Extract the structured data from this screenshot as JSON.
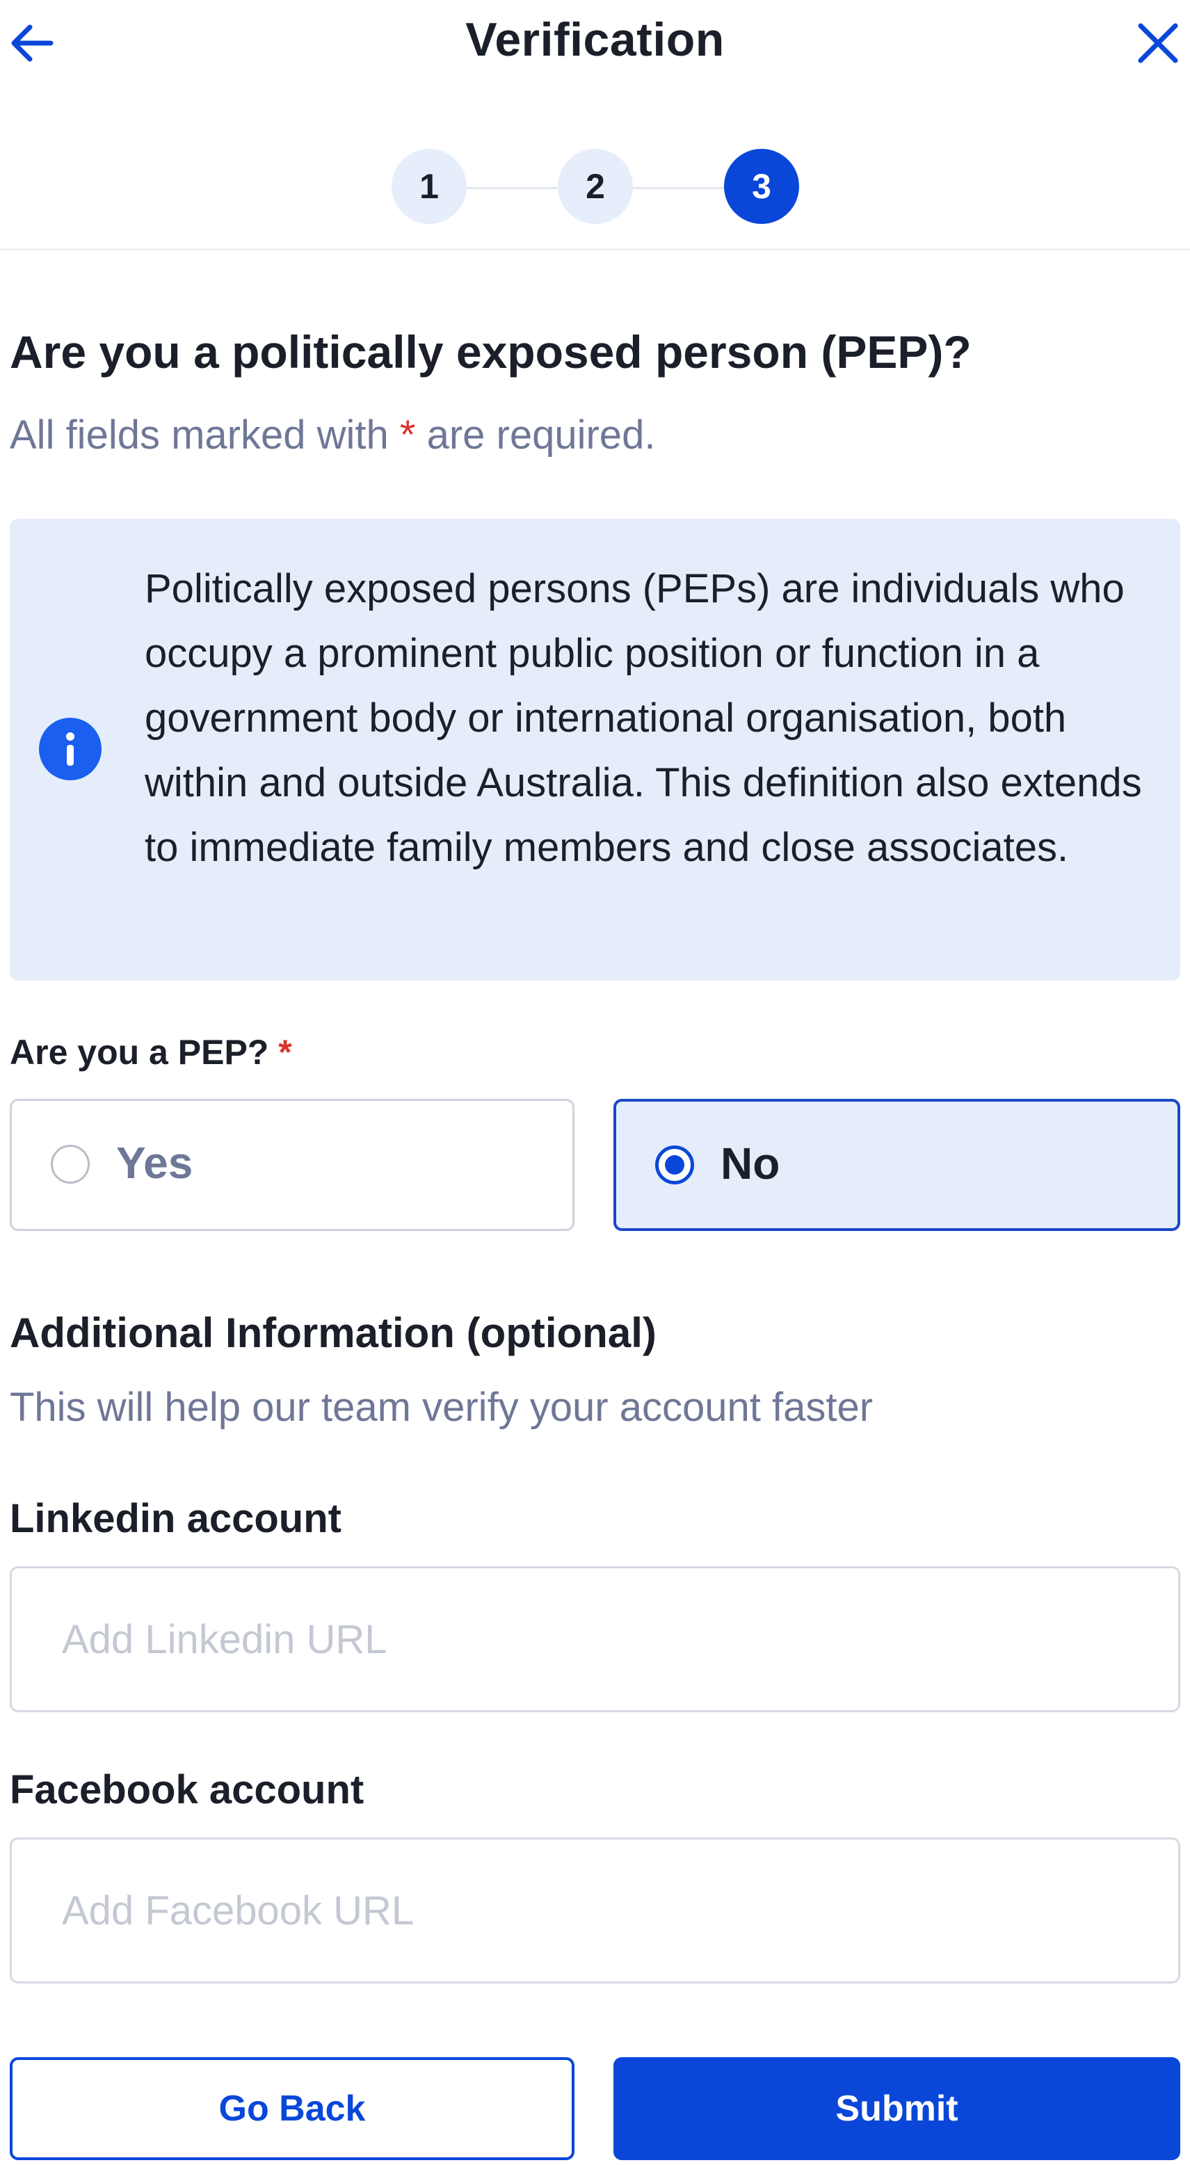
{
  "header": {
    "title": "Verification",
    "back_icon": "arrow-left-icon",
    "close_icon": "close-icon"
  },
  "stepper": {
    "steps": [
      {
        "label": "1",
        "state": "complete"
      },
      {
        "label": "2",
        "state": "complete"
      },
      {
        "label": "3",
        "state": "active"
      }
    ],
    "current_step": 3
  },
  "question": {
    "title": "Are you a politically exposed person (PEP)?",
    "required_note_prefix": "All fields marked with",
    "required_note_asterisk": "*",
    "required_note_suffix": "are required."
  },
  "info_box": {
    "icon": "info-icon",
    "text": "Politically exposed persons (PEPs) are individuals who occupy a prominent public position or function in a government body or international organisation, both within and outside Australia. This definition also extends to immediate family members and close associates."
  },
  "pep_field": {
    "label": "Are you a PEP?",
    "required_marker": "*",
    "options": [
      {
        "label": "Yes",
        "selected": false
      },
      {
        "label": "No",
        "selected": true
      }
    ]
  },
  "additional": {
    "title": "Additional Information (optional)",
    "subtitle": "This will help our team verify your account faster"
  },
  "linkedin": {
    "label": "Linkedin account",
    "placeholder": "Add Linkedin URL",
    "value": ""
  },
  "facebook": {
    "label": "Facebook account",
    "placeholder": "Add Facebook URL",
    "value": ""
  },
  "actions": {
    "back_label": "Go Back",
    "submit_label": "Submit"
  },
  "colors": {
    "primary": "#0a47d9",
    "info_bg": "#e5edfb",
    "required": "#d8342c",
    "muted_text": "#6e7796"
  }
}
